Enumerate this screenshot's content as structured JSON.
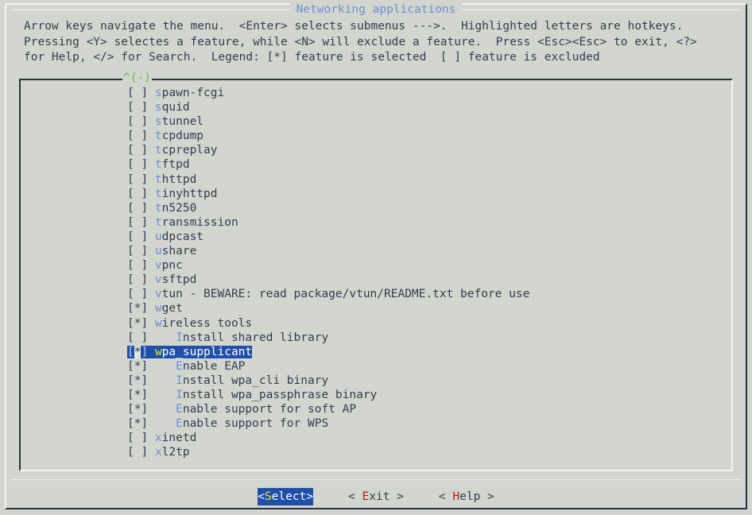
{
  "window": {
    "title": "Networking applications"
  },
  "help": {
    "line1": "Arrow keys navigate the menu.  <Enter> selects submenus --->.  Highlighted letters are hotkeys.",
    "line2": "Pressing <Y> selectes a feature, while <N> will exclude a feature.  Press <Esc><Esc> to exit, <?>",
    "line3": "for Help, </> for Search.  Legend: [*] feature is selected  [ ] feature is excluded"
  },
  "list": {
    "scroll_up_indicator": "^(-)",
    "items": [
      {
        "mark": "[ ]",
        "indent": 0,
        "hotkey": "s",
        "rest": "pawn-fcgi",
        "selected": false
      },
      {
        "mark": "[ ]",
        "indent": 0,
        "hotkey": "s",
        "rest": "quid",
        "selected": false
      },
      {
        "mark": "[ ]",
        "indent": 0,
        "hotkey": "s",
        "rest": "tunnel",
        "selected": false
      },
      {
        "mark": "[ ]",
        "indent": 0,
        "hotkey": "t",
        "rest": "cpdump",
        "selected": false
      },
      {
        "mark": "[ ]",
        "indent": 0,
        "hotkey": "t",
        "rest": "cpreplay",
        "selected": false
      },
      {
        "mark": "[ ]",
        "indent": 0,
        "hotkey": "t",
        "rest": "ftpd",
        "selected": false
      },
      {
        "mark": "[ ]",
        "indent": 0,
        "hotkey": "t",
        "rest": "httpd",
        "selected": false
      },
      {
        "mark": "[ ]",
        "indent": 0,
        "hotkey": "t",
        "rest": "inyhttpd",
        "selected": false
      },
      {
        "mark": "[ ]",
        "indent": 0,
        "hotkey": "t",
        "rest": "n5250",
        "selected": false
      },
      {
        "mark": "[ ]",
        "indent": 0,
        "hotkey": "t",
        "rest": "ransmission",
        "selected": false
      },
      {
        "mark": "[ ]",
        "indent": 0,
        "hotkey": "u",
        "rest": "dpcast",
        "selected": false
      },
      {
        "mark": "[ ]",
        "indent": 0,
        "hotkey": "u",
        "rest": "share",
        "selected": false
      },
      {
        "mark": "[ ]",
        "indent": 0,
        "hotkey": "v",
        "rest": "pnc",
        "selected": false
      },
      {
        "mark": "[ ]",
        "indent": 0,
        "hotkey": "v",
        "rest": "sftpd",
        "selected": false
      },
      {
        "mark": "[ ]",
        "indent": 0,
        "hotkey": "v",
        "rest": "tun - BEWARE: read package/vtun/README.txt before use",
        "selected": false
      },
      {
        "mark": "[*]",
        "indent": 0,
        "hotkey": "w",
        "rest": "get",
        "selected": false
      },
      {
        "mark": "[*]",
        "indent": 0,
        "hotkey": "w",
        "rest": "ireless tools",
        "selected": false
      },
      {
        "mark": "[ ]",
        "indent": 3,
        "hotkey": "I",
        "rest": "nstall shared library",
        "selected": false
      },
      {
        "mark": "[*]",
        "indent": 0,
        "hotkey": "w",
        "rest": "pa_supplicant",
        "selected": true
      },
      {
        "mark": "[*]",
        "indent": 3,
        "hotkey": "E",
        "rest": "nable EAP",
        "selected": false
      },
      {
        "mark": "[*]",
        "indent": 3,
        "hotkey": "I",
        "rest": "nstall wpa_cli binary",
        "selected": false
      },
      {
        "mark": "[*]",
        "indent": 3,
        "hotkey": "I",
        "rest": "nstall wpa_passphrase binary",
        "selected": false
      },
      {
        "mark": "[*]",
        "indent": 3,
        "hotkey": "E",
        "rest": "nable support for soft AP",
        "selected": false
      },
      {
        "mark": "[*]",
        "indent": 3,
        "hotkey": "E",
        "rest": "nable support for WPS",
        "selected": false
      },
      {
        "mark": "[ ]",
        "indent": 0,
        "hotkey": "x",
        "rest": "inetd",
        "selected": false
      },
      {
        "mark": "[ ]",
        "indent": 0,
        "hotkey": "x",
        "rest": "l2tp",
        "selected": false
      }
    ]
  },
  "buttons": [
    {
      "prefix": "<",
      "hotkey": "S",
      "rest": "elect",
      "suffix": ">",
      "active": true
    },
    {
      "prefix": "< ",
      "hotkey": "E",
      "rest": "xit",
      "suffix": " >",
      "active": false
    },
    {
      "prefix": "< ",
      "hotkey": "H",
      "rest": "elp",
      "suffix": " >",
      "active": false
    }
  ],
  "colors": {
    "background": "#d3d6ce",
    "text": "#313d52",
    "hotkey_blue": "#6b8fd4",
    "hotkey_red": "#c01616",
    "hotkey_yellow": "#e8e33c",
    "highlight_bg": "#1f4fa8",
    "title_blue": "#6b8fd4",
    "scroll_green": "#54c24a"
  }
}
